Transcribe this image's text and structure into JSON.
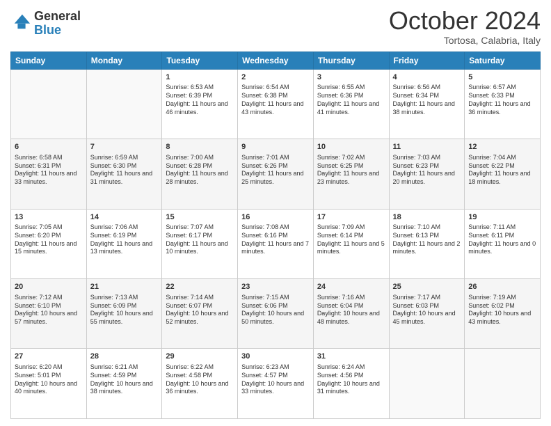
{
  "logo": {
    "line1": "General",
    "line2": "Blue"
  },
  "header": {
    "month": "October 2024",
    "location": "Tortosa, Calabria, Italy"
  },
  "weekdays": [
    "Sunday",
    "Monday",
    "Tuesday",
    "Wednesday",
    "Thursday",
    "Friday",
    "Saturday"
  ],
  "weeks": [
    [
      {
        "day": "",
        "info": ""
      },
      {
        "day": "",
        "info": ""
      },
      {
        "day": "1",
        "info": "Sunrise: 6:53 AM\nSunset: 6:39 PM\nDaylight: 11 hours and 46 minutes."
      },
      {
        "day": "2",
        "info": "Sunrise: 6:54 AM\nSunset: 6:38 PM\nDaylight: 11 hours and 43 minutes."
      },
      {
        "day": "3",
        "info": "Sunrise: 6:55 AM\nSunset: 6:36 PM\nDaylight: 11 hours and 41 minutes."
      },
      {
        "day": "4",
        "info": "Sunrise: 6:56 AM\nSunset: 6:34 PM\nDaylight: 11 hours and 38 minutes."
      },
      {
        "day": "5",
        "info": "Sunrise: 6:57 AM\nSunset: 6:33 PM\nDaylight: 11 hours and 36 minutes."
      }
    ],
    [
      {
        "day": "6",
        "info": "Sunrise: 6:58 AM\nSunset: 6:31 PM\nDaylight: 11 hours and 33 minutes."
      },
      {
        "day": "7",
        "info": "Sunrise: 6:59 AM\nSunset: 6:30 PM\nDaylight: 11 hours and 31 minutes."
      },
      {
        "day": "8",
        "info": "Sunrise: 7:00 AM\nSunset: 6:28 PM\nDaylight: 11 hours and 28 minutes."
      },
      {
        "day": "9",
        "info": "Sunrise: 7:01 AM\nSunset: 6:26 PM\nDaylight: 11 hours and 25 minutes."
      },
      {
        "day": "10",
        "info": "Sunrise: 7:02 AM\nSunset: 6:25 PM\nDaylight: 11 hours and 23 minutes."
      },
      {
        "day": "11",
        "info": "Sunrise: 7:03 AM\nSunset: 6:23 PM\nDaylight: 11 hours and 20 minutes."
      },
      {
        "day": "12",
        "info": "Sunrise: 7:04 AM\nSunset: 6:22 PM\nDaylight: 11 hours and 18 minutes."
      }
    ],
    [
      {
        "day": "13",
        "info": "Sunrise: 7:05 AM\nSunset: 6:20 PM\nDaylight: 11 hours and 15 minutes."
      },
      {
        "day": "14",
        "info": "Sunrise: 7:06 AM\nSunset: 6:19 PM\nDaylight: 11 hours and 13 minutes."
      },
      {
        "day": "15",
        "info": "Sunrise: 7:07 AM\nSunset: 6:17 PM\nDaylight: 11 hours and 10 minutes."
      },
      {
        "day": "16",
        "info": "Sunrise: 7:08 AM\nSunset: 6:16 PM\nDaylight: 11 hours and 7 minutes."
      },
      {
        "day": "17",
        "info": "Sunrise: 7:09 AM\nSunset: 6:14 PM\nDaylight: 11 hours and 5 minutes."
      },
      {
        "day": "18",
        "info": "Sunrise: 7:10 AM\nSunset: 6:13 PM\nDaylight: 11 hours and 2 minutes."
      },
      {
        "day": "19",
        "info": "Sunrise: 7:11 AM\nSunset: 6:11 PM\nDaylight: 11 hours and 0 minutes."
      }
    ],
    [
      {
        "day": "20",
        "info": "Sunrise: 7:12 AM\nSunset: 6:10 PM\nDaylight: 10 hours and 57 minutes."
      },
      {
        "day": "21",
        "info": "Sunrise: 7:13 AM\nSunset: 6:09 PM\nDaylight: 10 hours and 55 minutes."
      },
      {
        "day": "22",
        "info": "Sunrise: 7:14 AM\nSunset: 6:07 PM\nDaylight: 10 hours and 52 minutes."
      },
      {
        "day": "23",
        "info": "Sunrise: 7:15 AM\nSunset: 6:06 PM\nDaylight: 10 hours and 50 minutes."
      },
      {
        "day": "24",
        "info": "Sunrise: 7:16 AM\nSunset: 6:04 PM\nDaylight: 10 hours and 48 minutes."
      },
      {
        "day": "25",
        "info": "Sunrise: 7:17 AM\nSunset: 6:03 PM\nDaylight: 10 hours and 45 minutes."
      },
      {
        "day": "26",
        "info": "Sunrise: 7:19 AM\nSunset: 6:02 PM\nDaylight: 10 hours and 43 minutes."
      }
    ],
    [
      {
        "day": "27",
        "info": "Sunrise: 6:20 AM\nSunset: 5:01 PM\nDaylight: 10 hours and 40 minutes."
      },
      {
        "day": "28",
        "info": "Sunrise: 6:21 AM\nSunset: 4:59 PM\nDaylight: 10 hours and 38 minutes."
      },
      {
        "day": "29",
        "info": "Sunrise: 6:22 AM\nSunset: 4:58 PM\nDaylight: 10 hours and 36 minutes."
      },
      {
        "day": "30",
        "info": "Sunrise: 6:23 AM\nSunset: 4:57 PM\nDaylight: 10 hours and 33 minutes."
      },
      {
        "day": "31",
        "info": "Sunrise: 6:24 AM\nSunset: 4:56 PM\nDaylight: 10 hours and 31 minutes."
      },
      {
        "day": "",
        "info": ""
      },
      {
        "day": "",
        "info": ""
      }
    ]
  ]
}
